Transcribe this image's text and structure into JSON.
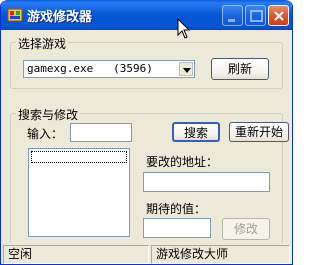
{
  "window": {
    "title": "游戏修改器",
    "controls": {
      "minimize_icon": "minimize-icon",
      "maximize_icon": "maximize-icon",
      "close_icon": "close-icon"
    }
  },
  "game_group": {
    "title": "选择游戏",
    "process_value": "gamexg.exe   (3596)",
    "refresh_label": "刷新"
  },
  "search_group": {
    "title": "搜索与修改",
    "input_label": "输入：",
    "search_value": "",
    "search_label": "搜索",
    "restart_label": "重新开始",
    "address_label": "要改的地址：",
    "address_value": "",
    "expected_label": "期待的值：",
    "expected_value": "",
    "modify_label": "修改"
  },
  "statusbar": {
    "left": "空闲",
    "right": "游戏修改大师"
  },
  "colors": {
    "titlebar": "#0a59d6",
    "window_bg": "#ece9d8",
    "close_button": "#d9532c"
  }
}
